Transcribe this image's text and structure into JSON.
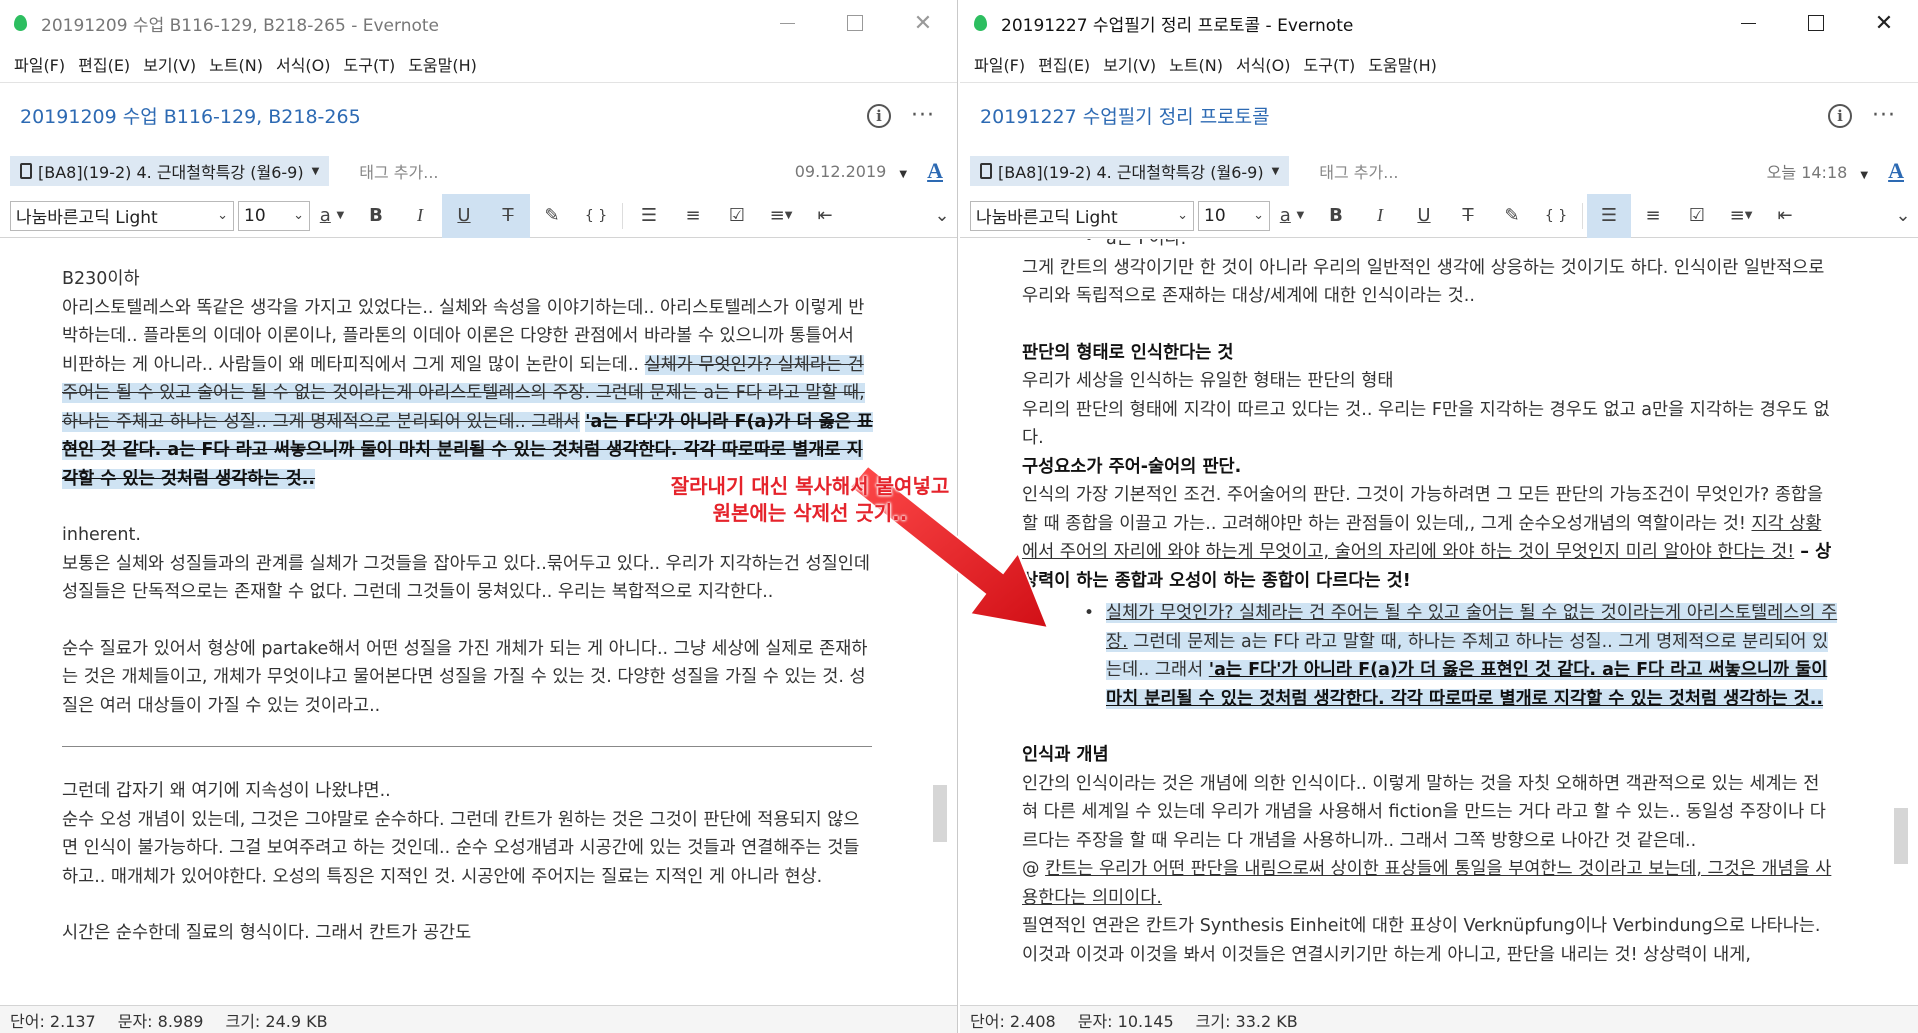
{
  "left_window": {
    "title": "20191209 수업 B116-129, B218-265 - Evernote",
    "menu": [
      "파일(F)",
      "편집(E)",
      "보기(V)",
      "노트(N)",
      "서식(O)",
      "도구(T)",
      "도움말(H)"
    ],
    "note_title": "20191209 수업 B116-129, B218-265",
    "notebook": "[BA8](19-2) 4. 근대철학특강 (월6-9)",
    "tag_placeholder": "태그 추가...",
    "date": "09.12.2019",
    "font": "나눔바른고딕 Light",
    "font_size": "10",
    "body": {
      "p1_heading": "B230이하",
      "p1_text": "아리스토텔레스와 똑같은 생각을 가지고 있었다는.. 실체와 속성을 이야기하는데.. 아리스토텔레스가 이렇게 반박하는데.. 플라톤의 이데아 이론이나, 플라톤의 이데아 이론은 다양한 관점에서 바라볼 수 있으니까 통틀어서 비판하는 게 아니라.. 사람들이 왜 메타피직에서 그게 제일 많이 논란이 되는데..",
      "p1_struck": "실체가 무엇인가? 실체라는 건 주어는 될 수 있고 술어는 될 수 없는 것이라는게 아리스토텔레스의 주장. 그런데 문제는 a는 F다 라고 말할 때, 하나는 주체고 하나는 성질.. 그게 명제적으로 분리되어 있는데.. 그래서",
      "p1_bold": "'a는 F다'가 아니라 F(a)가 더 옳은 표현인 것 같다. a는 F다 라고 써놓으니까 둘이 마치 분리될 수 있는 것처럼 생각한다. 각각 따로따로 별개로 지각할 수 있는 것처럼 생각하는 것..",
      "p2_heading": "inherent.",
      "p2_text": "보통은 실체와 성질들과의 관계를 실체가 그것들을 잡아두고 있다..묶어두고 있다.. 우리가 지각하는건 성질인데 성질들은 단독적으로는 존재할 수 없다. 그런데 그것들이 뭉쳐있다.. 우리는 복합적으로 지각한다..",
      "p3_text": "순수 질료가 있어서 형상에 partake해서 어떤 성질을 가진 개체가 되는 게 아니다.. 그냥 세상에 실제로 존재하는 것은 개체들이고, 개체가 무엇이냐고 물어본다면 성질을 가질 수 있는 것. 다양한 성질을 가질 수 있는 것. 성질은 여러 대상들이 가질 수 있는 것이라고..",
      "p4_text1": "그런데 갑자기 왜 여기에 지속성이 나왔냐면..",
      "p4_text2": "순수 오성 개념이 있는데, 그것은 그야말로 순수하다. 그런데 칸트가 원하는 것은 그것이 판단에 적용되지 않으면 인식이 불가능하다. 그걸 보여주려고 하는 것인데.. 순수 오성개념과 시공간에 있는 것들과 연결해주는 것들하고.. 매개체가 있어야한다. 오성의 특징은 지적인 것. 시공안에 주어지는 질료는 지적인 게 아니라 현상.",
      "p5_text": "시간은 순수한데 질료의 형식이다. 그래서 칸트가 공간도"
    },
    "status": {
      "words": "단어: 2.137",
      "chars": "문자: 8.989",
      "size": "크기: 24.9 KB"
    }
  },
  "right_window": {
    "title": "20191227 수업필기 정리 프로토콜 - Evernote",
    "menu": [
      "파일(F)",
      "편집(E)",
      "보기(V)",
      "노트(N)",
      "서식(O)",
      "도구(T)",
      "도움말(H)"
    ],
    "note_title": "20191227 수업필기 정리 프로토콜",
    "notebook": "[BA8](19-2) 4. 근대철학특강 (월6-9)",
    "tag_placeholder": "태그 추가...",
    "date": "오늘 14:18",
    "font": "나눔바른고딕 Light",
    "font_size": "10",
    "body": {
      "top_bullet": "a는 F이다.",
      "p1_text": "그게 칸트의 생각이기만 한 것이 아니라 우리의 일반적인 생각에 상응하는 것이기도 하다. 인식이란 일반적으로 우리와 독립적으로 존재하는 대상/세계에 대한 인식이라는 것..",
      "h2": "판단의 형태로 인식한다는 것",
      "p2_line1": "우리가 세상을 인식하는 유일한 형태는 판단의 형태",
      "p2_line2": "우리의 판단의 형태에 지각이 따르고 있다는 것.. 우리는 F만을 지각하는 경우도 없고 a만을 지각하는 경우도 없다.",
      "h3": "구성요소가 주어-술어의 판단.",
      "p3_text": "인식의 가장 기본적인 조건. 주어술어의 판단. 그것이 가능하려면 그 모든 판단의 가능조건이 무엇인가? 종합을 할 때 종합을 이끌고 가는.. 고려해야만 하는 관점들이 있는데,, 그게 순수오성개념의 역할이라는 것!",
      "p3_underlined": "지각 상황에서 주어의 자리에 와야 하는게 무엇이고, 술어의 자리에 와야 하는 것이 무엇인지 미리 알아야 한다는 것!",
      "p3_bold": " – 상상력이 하는 종합과 오성이 하는 종합이 다르다는 것!",
      "pasted_underlined": "실체가 무엇인가? 실체라는 건 주어는 될 수 있고 술어는 될 수 없는 것이라는게 아리스토텔레스의 주장.",
      "pasted_text": " 그런데 문제는 a는 F다 라고 말할 때, 하나는 주체고 하나는 성질.. 그게 명제적으로 분리되어 있는데.. 그래서 ",
      "pasted_bold": "'a는 F다'가 아니라 F(a)가 더 옳은 표현인 것 같다. a는 F다 라고 써놓으니까 둘이 마치 분리될 수 있는 것처럼 생각한다. 각각 따로따로 별개로 지각할 수 있는 것처럼 생각하는 것..",
      "h4": "인식과 개념",
      "p4_text": "인간의 인식이라는 것은 개념에 의한 인식이다.. 이렇게 말하는 것을 자칫 오해하면 객관적으로 있는 세계는 전혀 다른 세계일 수 있는데 우리가 개념을 사용해서 fiction을 만드는 거다 라고 할 수 있는.. 동일성 주장이나 다르다는 주장을 할 때 우리는 다 개념을 사용하니까.. 그래서 그쪽 방향으로 나아간 것 같은데..",
      "p5_prefix": "@ ",
      "p5_underlined": "칸트는 우리가 어떤 판단을 내림으로써 상이한 표상들에 통일을 부여한느 것이라고 보는데, 그것은 개념을 사용한다는 의미이다.",
      "p6_text": "필연적인 연관은 칸트가 Synthesis Einheit에 대한 표상이 Verknüpfung이나 Verbindung으로 나타나는. 이것과 이것과 이것을 봐서 이것들은 연결시키기만 하는게 아니고, 판단을 내리는 것! 상상력이 내게,"
    },
    "status": {
      "words": "단어: 2.408",
      "chars": "문자: 10.145",
      "size": "크기: 33.2 KB"
    }
  },
  "annotation": {
    "line1": "잘라내기 대신 복사해서 붙여넣고",
    "line2": "원본에는 삭제선 긋기..",
    "color": "#e5232b"
  },
  "colors": {
    "accent": "#2d6ab3",
    "highlight": "#cfe3f3",
    "toolbar_active": "#cfe1f2",
    "app_green": "#2dbe60"
  }
}
